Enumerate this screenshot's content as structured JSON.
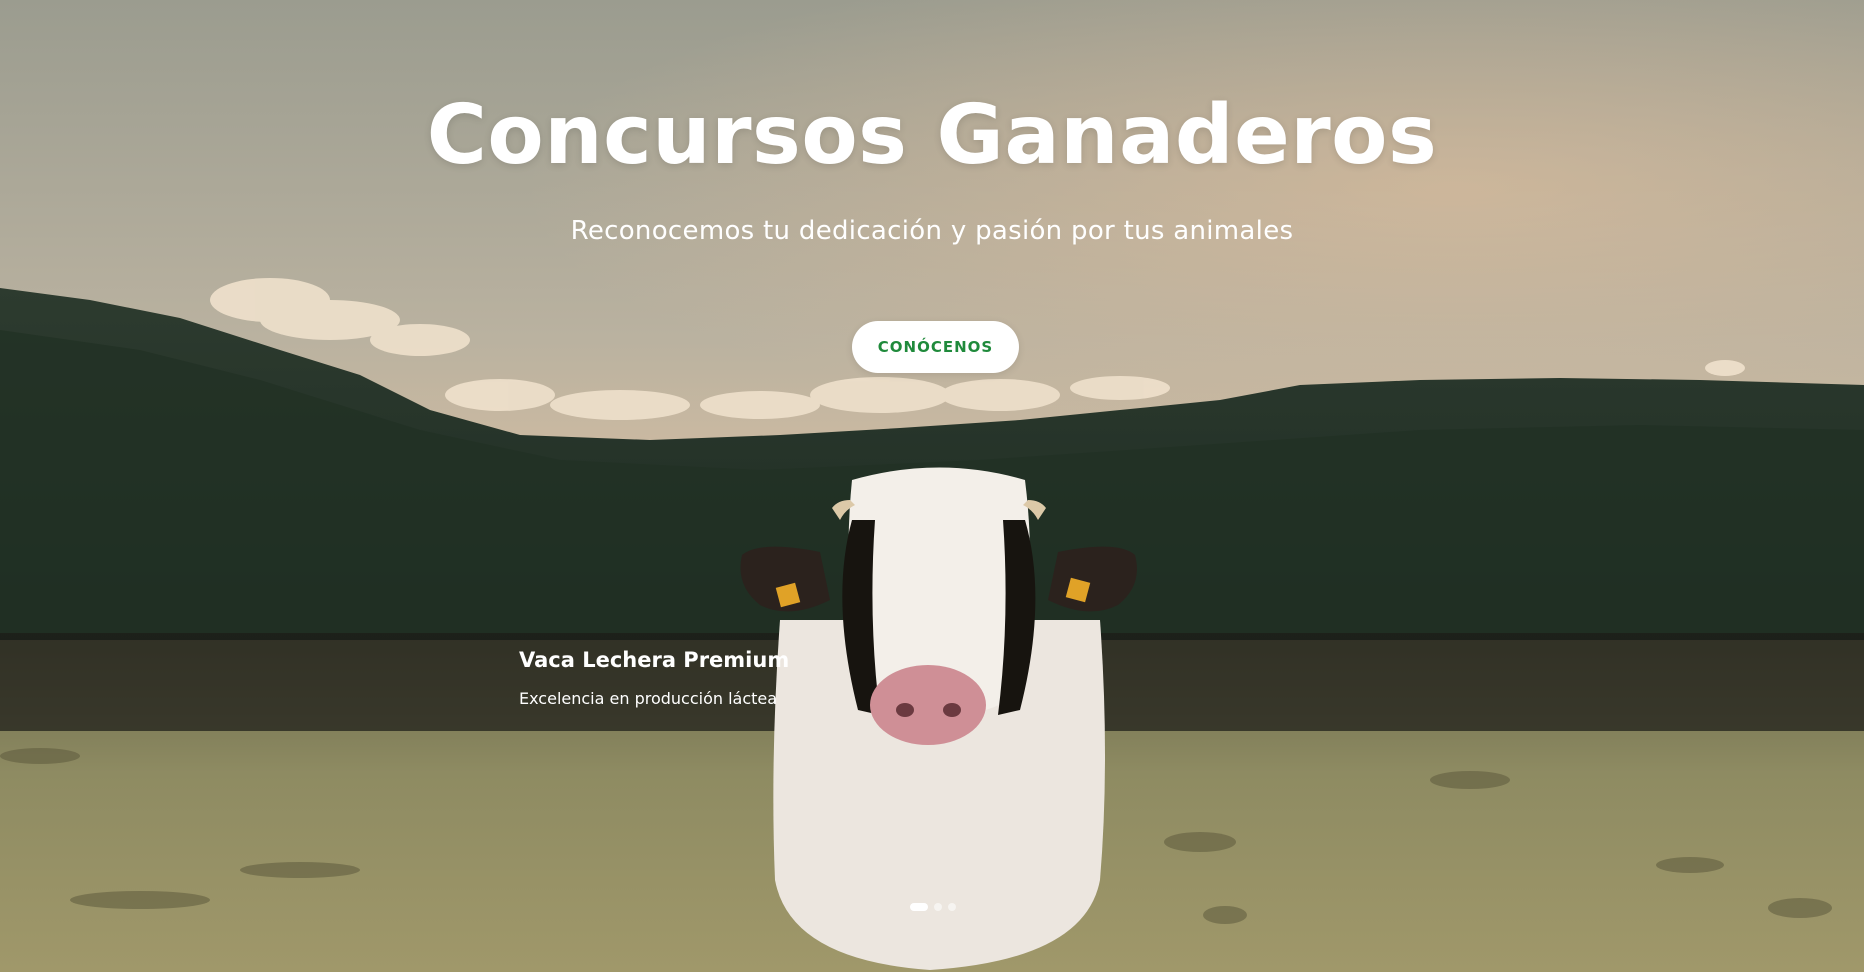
{
  "hero": {
    "title": "Concursos Ganaderos",
    "subtitle": "Reconocemos tu dedicación y pasión por tus animales",
    "cta_label": "CONÓCENOS"
  },
  "slide": {
    "title": "Vaca Lechera Premium",
    "description": "Excelencia en producción láctea"
  },
  "carousel": {
    "slide_count": 3,
    "active_index": 0
  },
  "colors": {
    "cta_text": "#1f8a3b",
    "cta_background": "#ffffff",
    "caption_band": "#1c1c18"
  }
}
